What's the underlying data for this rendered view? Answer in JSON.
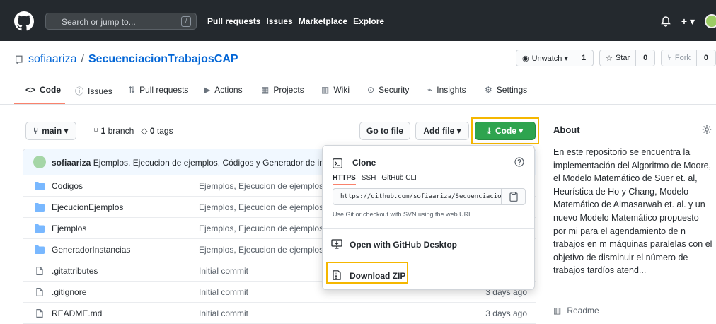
{
  "header": {
    "search_placeholder": "Search or jump to...",
    "slash_key": "/",
    "nav": [
      "Pull requests",
      "Issues",
      "Marketplace",
      "Explore"
    ],
    "plus": "+ ▾"
  },
  "repo": {
    "owner": "sofiaariza",
    "separator": "/",
    "name": "SecuenciacionTrabajosCAP",
    "watch_label": "Unwatch ▾",
    "watch_count": "1",
    "star_label": "Star",
    "star_count": "0",
    "fork_label": "Fork",
    "fork_count": "0"
  },
  "tabs": [
    {
      "label": "Code",
      "icon": "<>"
    },
    {
      "label": "Issues",
      "icon": "ⓘ"
    },
    {
      "label": "Pull requests",
      "icon": "⇅"
    },
    {
      "label": "Actions",
      "icon": "▶"
    },
    {
      "label": "Projects",
      "icon": "▦"
    },
    {
      "label": "Wiki",
      "icon": "▥"
    },
    {
      "label": "Security",
      "icon": "⊙"
    },
    {
      "label": "Insights",
      "icon": "⌁"
    },
    {
      "label": "Settings",
      "icon": "⚙"
    }
  ],
  "filenav": {
    "branch": "main ▾",
    "branch_count": "1",
    "branch_word": "branch",
    "tags_count": "0",
    "tags_word": "tags",
    "goto_file": "Go to file",
    "add_file": "Add file ▾",
    "code_button": "Code ▾"
  },
  "commit": {
    "author": "sofiaariza",
    "message": "Ejemplos, Ejecucion de ejemplos, Códigos y Generador de instancia"
  },
  "files": [
    {
      "name": "Codigos",
      "type": "dir",
      "message": "Ejemplos, Ejecucion de ejemplos, C",
      "age": ""
    },
    {
      "name": "EjecucionEjemplos",
      "type": "dir",
      "message": "Ejemplos, Ejecucion de ejemplos, C",
      "age": ""
    },
    {
      "name": "Ejemplos",
      "type": "dir",
      "message": "Ejemplos, Ejecucion de ejemplos, C",
      "age": ""
    },
    {
      "name": "GeneradorInstancias",
      "type": "dir",
      "message": "Ejemplos, Ejecucion de ejemplos, C",
      "age": ""
    },
    {
      "name": ".gitattributes",
      "type": "file",
      "message": "Initial commit",
      "age": ""
    },
    {
      "name": ".gitignore",
      "type": "file",
      "message": "Initial commit",
      "age": "3 days ago"
    },
    {
      "name": "README.md",
      "type": "file",
      "message": "Initial commit",
      "age": "3 days ago"
    }
  ],
  "dropdown": {
    "clone_title": "Clone",
    "tabs": [
      "HTTPS",
      "SSH",
      "GitHub CLI"
    ],
    "url": "https://github.com/sofiaariza/SecuenciacionTrabajosCAP.git",
    "hint": "Use Git or checkout with SVN using the web URL.",
    "open_desktop": "Open with GitHub Desktop",
    "download_zip": "Download ZIP"
  },
  "about": {
    "title": "About",
    "description": "En este repositorio se encuentra la implementación del Algoritmo de Moore, el Modelo Matemático de Süer et. al, Heurística de Ho y Chang, Modelo Matemático de Almasarwah et. al. y un nuevo Modelo Matemático propuesto por mi para el agendamiento de n trabajos en m máquinas paralelas con el objetivo de disminuir el número de trabajos tardíos atend...",
    "readme": "Readme"
  },
  "colors": {
    "header_bg": "#24292e",
    "link": "#0366d6",
    "code_button": "#2ea44f",
    "highlight": "#f5b700",
    "tab_underline": "#f9826c",
    "folder": "#79b8ff"
  }
}
